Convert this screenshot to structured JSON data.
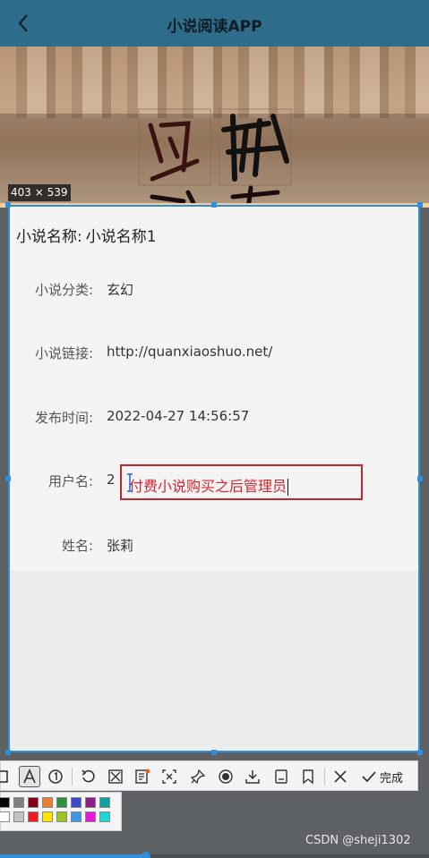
{
  "header": {
    "title": "小说阅读APP",
    "back_icon": "chevron-left-icon"
  },
  "capture": {
    "size_badge": "403 × 539"
  },
  "novel": {
    "title_label": "小说名称:",
    "title_value": "小说名称1",
    "fields": [
      {
        "label": "小说分类:",
        "value": "玄幻"
      },
      {
        "label": "小说链接:",
        "value": "http://quanxiaoshuo.net/"
      },
      {
        "label": "发布时间:",
        "value": "2022-04-27 14:56:57"
      },
      {
        "label": "用户名:",
        "value": "2"
      },
      {
        "label": "姓名:",
        "value": "张莉"
      }
    ]
  },
  "annotation": {
    "text": "付费小说购买之后管理员"
  },
  "toolbar": {
    "tools": [
      "rectangle-icon",
      "text-icon",
      "number-icon",
      "undo-icon",
      "mosaic-icon",
      "ocr-icon",
      "translate-icon",
      "pin-icon",
      "record-icon",
      "download-icon",
      "save-icon",
      "bookmark-icon",
      "close-icon"
    ],
    "done_label": "完成"
  },
  "palette": {
    "colors": [
      "#000000",
      "#7f7f7f",
      "#880015",
      "#ed7d31",
      "#2f8f3f",
      "#3f48cc",
      "#8c1d8c",
      "#10a0a0",
      "#ffffff",
      "#c3c3c3",
      "#ed1c24",
      "#ffe600",
      "#9dc41d",
      "#3f96e6",
      "#e619d7",
      "#1ed6d6"
    ]
  },
  "watermark": "CSDN @sheji1302",
  "progress": {
    "fraction": 0.34
  }
}
